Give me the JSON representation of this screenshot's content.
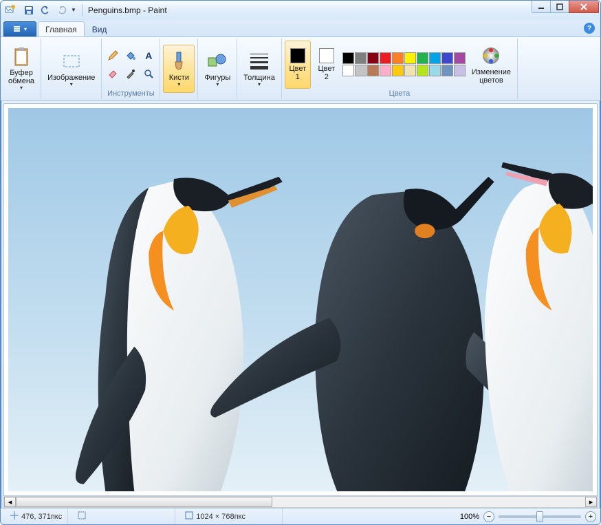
{
  "title": "Penguins.bmp - Paint",
  "tabs": {
    "home": "Главная",
    "view": "Вид"
  },
  "groups": {
    "clipboard": "Буфер\nобмена",
    "image": "Изображение",
    "tools": "Инструменты",
    "brushes": "Кисти",
    "shapes": "Фигуры",
    "size": "Толщина",
    "color1": "Цвет\n1",
    "color2": "Цвет\n2",
    "edit_colors": "Изменение\nцветов",
    "colors_label": "Цвета"
  },
  "palette_row1": [
    "#000000",
    "#7f7f7f",
    "#880015",
    "#ed1c24",
    "#ff7f27",
    "#fff200",
    "#22b14c",
    "#00a2e8",
    "#3f48cc",
    "#a349a4"
  ],
  "palette_row2": [
    "#ffffff",
    "#c3c3c3",
    "#b97a57",
    "#ffaec9",
    "#ffc90e",
    "#efe4b0",
    "#b5e61d",
    "#99d9ea",
    "#7092be",
    "#c8bfe7"
  ],
  "active_color1": "#000000",
  "active_color2": "#ffffff",
  "status": {
    "cursor": "476, 371пкс",
    "selection": "",
    "size": "1024 × 768пкс",
    "zoom": "100%"
  }
}
